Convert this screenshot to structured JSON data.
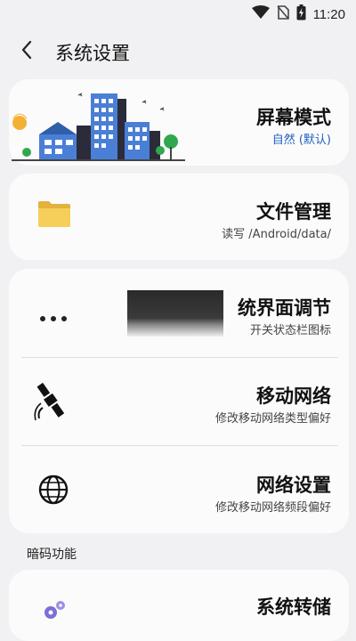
{
  "status_bar": {
    "time": "11:20",
    "icons": [
      "wifi-icon",
      "no-sim-icon",
      "battery-charging-icon"
    ]
  },
  "header": {
    "title": "系统设置",
    "back_icon": "chevron-left-icon"
  },
  "cards": {
    "screen_mode": {
      "title": "屏幕模式",
      "subtitle": "自然 (默认)",
      "icon": "city-illustration-icon"
    },
    "file_manager": {
      "title": "文件管理",
      "subtitle": "读写 /Android/data/",
      "icon": "folder-icon"
    },
    "settings_group": [
      {
        "title": "统界面调节",
        "subtitle": "开关状态栏图标",
        "icon": "more-dots-icon"
      },
      {
        "title": "移动网络",
        "subtitle": "修改移动网络类型偏好",
        "icon": "satellite-icon"
      },
      {
        "title": "网络设置",
        "subtitle": "修改移动网络频段偏好",
        "icon": "globe-icon"
      }
    ]
  },
  "section": {
    "label": "暗码功能"
  },
  "bottom_card": {
    "title": "系统转储",
    "icon": "gears-icon"
  },
  "colors": {
    "background": "#f1f1f3",
    "card": "#fbfbfb",
    "accent": "#1f5fbf",
    "folder": "#f2c94c"
  }
}
